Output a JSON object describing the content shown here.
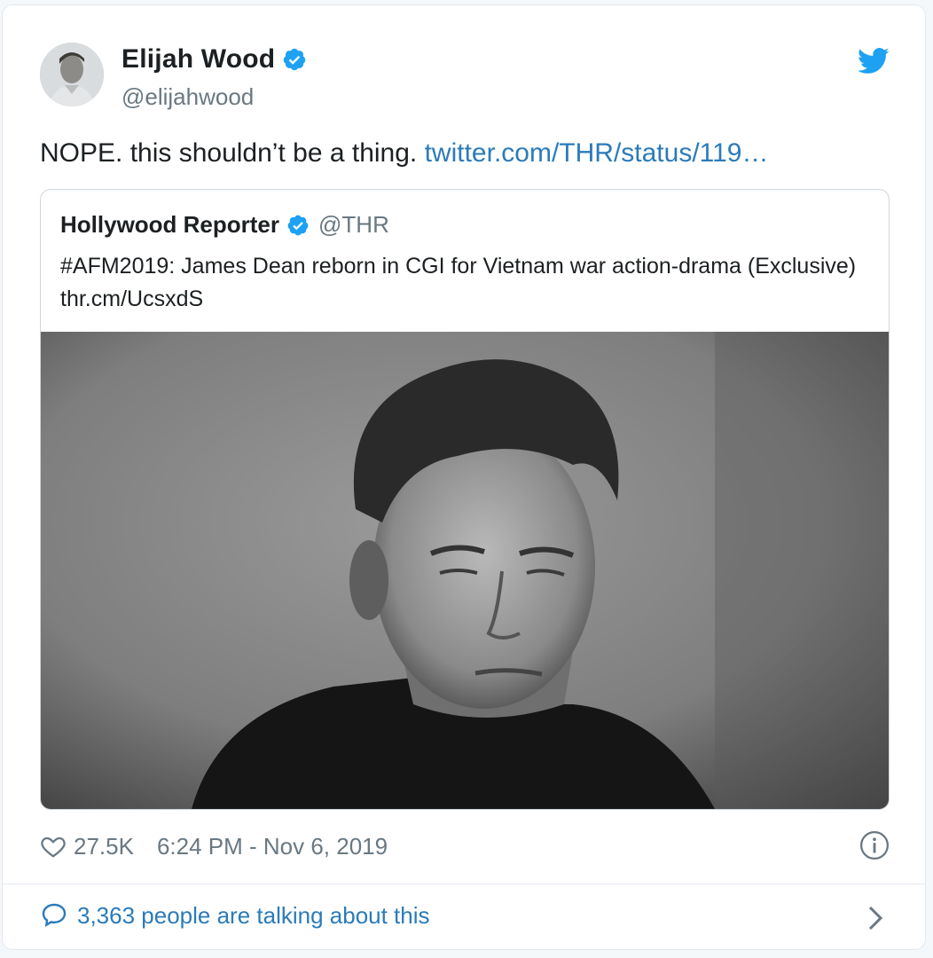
{
  "author": {
    "name": "Elijah Wood",
    "handle": "@elijahwood",
    "avatar_icon": "avatar-portrait"
  },
  "tweet": {
    "text": "NOPE. this shouldn’t be a thing.",
    "link": "twitter.com/THR/status/119…"
  },
  "quoted": {
    "name": "Hollywood Reporter",
    "handle": "@THR",
    "text": "#AFM2019: James Dean reborn in CGI for Vietnam war action-drama (Exclusive) thr.cm/UcsxdS",
    "image_icon": "black-and-white-portrait-photo"
  },
  "footer": {
    "likes": "27.5K",
    "timestamp": "6:24 PM - Nov 6, 2019"
  },
  "conversation": {
    "label": "3,363 people are talking about this"
  },
  "colors": {
    "link": "#2b7bb9",
    "twitter_blue": "#1da1f2",
    "muted": "#697882",
    "border": "#e1e8ed"
  },
  "icons": [
    "verified-badge-icon",
    "twitter-bird-icon",
    "heart-icon",
    "info-icon",
    "speech-bubble-icon",
    "chevron-right-icon"
  ]
}
